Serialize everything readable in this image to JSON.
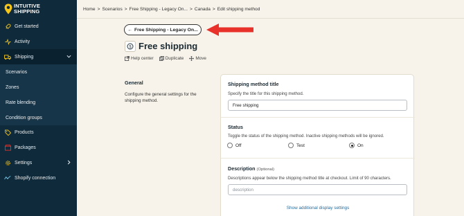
{
  "brand": {
    "line1": "INTUITIVE",
    "line2": "SHIPPING"
  },
  "sidebar": {
    "items": [
      {
        "label": "Get started",
        "icon": "rocket-icon"
      },
      {
        "label": "Activity",
        "icon": "activity-icon"
      },
      {
        "label": "Shipping",
        "icon": "truck-icon"
      },
      {
        "label": "Scenarios"
      },
      {
        "label": "Zones"
      },
      {
        "label": "Rate blending"
      },
      {
        "label": "Condition groups"
      },
      {
        "label": "Products",
        "icon": "tag-icon"
      },
      {
        "label": "Packages",
        "icon": "package-icon"
      },
      {
        "label": "Settings",
        "icon": "gear-icon"
      },
      {
        "label": "Shopify connection",
        "icon": "connection-icon"
      }
    ]
  },
  "breadcrumb": [
    "Home",
    ">",
    "Scenarios",
    ">",
    "Free Shipping - Legacy On...",
    ">",
    "Canada",
    ">",
    "Edit shipping method"
  ],
  "back_button": "Free Shipping - Legacy On...",
  "page_title": "Free shipping",
  "actions": {
    "help": "Help center",
    "duplicate": "Duplicate",
    "move": "Move"
  },
  "general": {
    "title": "General",
    "description": "Configure the general settings for the shipping method."
  },
  "form": {
    "method_title": {
      "label": "Shipping method title",
      "hint": "Specify the title for this shipping method.",
      "value": "Free shipping"
    },
    "status": {
      "label": "Status",
      "hint": "Toggle the status of the shipping method. Inactive shipping methods will be ignored.",
      "options": [
        "Off",
        "Test",
        "On"
      ],
      "selected": "On"
    },
    "description": {
      "label": "Description",
      "optional": "(Optional)",
      "hint": "Descriptions appear below the shipping method title at checkout. Limit of 90 characters.",
      "placeholder": "description"
    },
    "display_link": "Show additional display settings"
  },
  "colors": {
    "sidebar": "#0f2a3a",
    "background": "#f7f3ea",
    "accent": "#f5c518",
    "arrow": "#e8312a",
    "link": "#2a6b9a"
  }
}
